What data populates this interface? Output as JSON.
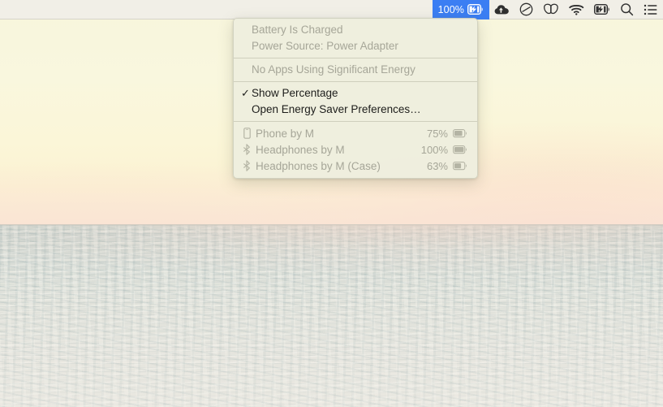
{
  "menubar": {
    "battery_status": {
      "percent_label": "100%",
      "icon": "battery-charging-icon",
      "selected": true,
      "highlight_color": "#3b7ef3",
      "highlight_text_color": "#ffffff"
    },
    "items": [
      {
        "name": "cloud-upload-icon",
        "label": ""
      },
      {
        "name": "do-not-disturb-icon",
        "label": ""
      },
      {
        "name": "butterfly-icon",
        "label": ""
      },
      {
        "name": "wifi-icon",
        "label": ""
      },
      {
        "name": "battery-charging-icon",
        "label": ""
      },
      {
        "name": "search-icon",
        "label": ""
      },
      {
        "name": "control-center-icon",
        "label": ""
      }
    ],
    "background_color": "#f0eee7"
  },
  "battery_menu": {
    "status_section": {
      "charge_state": "Battery Is Charged",
      "power_source": "Power Source: Power Adapter"
    },
    "energy_section": {
      "apps_energy": "No Apps Using Significant Energy"
    },
    "options_section": {
      "show_percentage": {
        "label": "Show Percentage",
        "checkmark": "✓",
        "checked": true
      },
      "energy_saver": {
        "label": "Open Energy Saver Preferences…"
      }
    },
    "devices": [
      {
        "icon": "iphone-icon",
        "name": "Phone by M",
        "percent": "75%",
        "level": 0.75
      },
      {
        "icon": "bluetooth-icon",
        "name": "Headphones by M",
        "percent": "100%",
        "level": 1.0
      },
      {
        "icon": "bluetooth-icon",
        "name": "Headphones by M (Case)",
        "percent": "63%",
        "level": 0.63
      }
    ]
  },
  "desktop": {
    "wallpaper": "ocean-horizon-pastel",
    "sky_color": "#f9f6dc",
    "sea_color": "#dfe0d9"
  }
}
